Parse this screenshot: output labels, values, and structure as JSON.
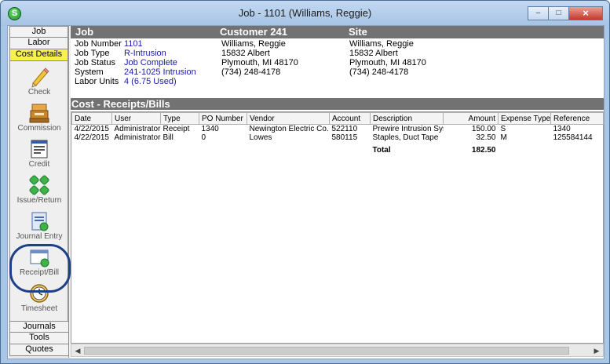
{
  "window": {
    "title": "Job - 1101 (Williams, Reggie)",
    "app_icon_letter": "S"
  },
  "sidebar": {
    "tabs_top": [
      "Job",
      "Labor",
      "Cost Details"
    ],
    "active_tab": "Cost Details",
    "items": [
      {
        "label": "Check",
        "icon": "pencil-icon"
      },
      {
        "label": "Commission",
        "icon": "cash-register-icon"
      },
      {
        "label": "Credit",
        "icon": "credit-document-icon"
      },
      {
        "label": "Issue/Return",
        "icon": "issue-return-icon"
      },
      {
        "label": "Journal Entry",
        "icon": "journal-entry-icon"
      },
      {
        "label": "Receipt/Bill",
        "icon": "receipt-bill-icon"
      },
      {
        "label": "Timesheet",
        "icon": "clock-icon"
      }
    ],
    "tabs_bottom": [
      "Journals",
      "Tools",
      "Quotes"
    ]
  },
  "info": {
    "headers": {
      "job": "Job",
      "customer": "Customer 241",
      "site": "Site"
    },
    "job": {
      "rows": [
        {
          "label": "Job Number",
          "value": "1101"
        },
        {
          "label": "Job Type",
          "value": "R-Intrusion"
        },
        {
          "label": "Job Status",
          "value": "Job Complete"
        },
        {
          "label": "System",
          "value": "241-1025 Intrusion"
        },
        {
          "label": "Labor Units",
          "value": "4 (6.75 Used)"
        }
      ]
    },
    "customer": [
      "Williams, Reggie",
      "15832 Albert",
      "Plymouth, MI  48170",
      "(734) 248-4178"
    ],
    "site": [
      "Williams, Reggie",
      "15832 Albert",
      "Plymouth, MI  48170",
      "(734) 248-4178"
    ]
  },
  "section_title": "Cost - Receipts/Bills",
  "table": {
    "columns": [
      "Date",
      "User",
      "Type",
      "PO Number",
      "Vendor",
      "Account",
      "Description",
      "Amount",
      "Expense Type",
      "Reference"
    ],
    "rows": [
      [
        "4/22/2015",
        "Administrator",
        "Receipt",
        "1340",
        "Newington Electric Co.",
        "522110",
        "Prewire Intrusion Syst...",
        "150.00",
        "S",
        "1340"
      ],
      [
        "4/22/2015",
        "Administrator",
        "Bill",
        "0",
        "Lowes",
        "580115",
        "Staples, Duct Tape",
        "32.50",
        "M",
        "125584144"
      ]
    ],
    "total_label": "Total",
    "total_value": "182.50"
  },
  "colors": {
    "active_tab": "#f7f24a",
    "header_bg": "#727272",
    "value_text": "#1a1aa8",
    "highlight_ring": "#1f3f86"
  }
}
